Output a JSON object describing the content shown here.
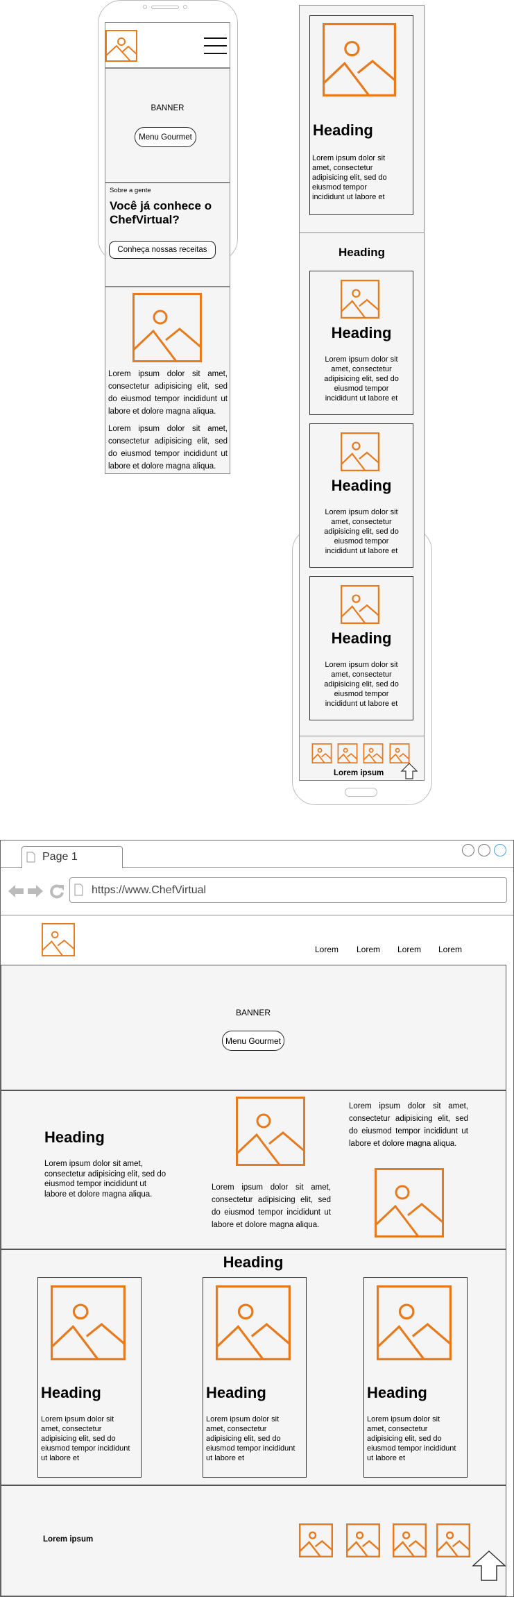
{
  "mobile_home": {
    "banner_label": "BANNER",
    "banner_button": "Menu Gourmet",
    "about_small": "Sobre a gente",
    "about_title": "Você já conhece o ChefVirtual?",
    "about_button": "Conheça nossas receitas",
    "para1": "Lorem ipsum dolor sit amet, consectetur adipisicing elit, sed do eiusmod tempor incididunt ut labore et dolore magna aliqua.",
    "para2": "Lorem ipsum dolor sit amet, consectetur adipisicing elit, sed do eiusmod tempor incididunt ut labore et dolore magna aliqua."
  },
  "mobile_list": {
    "top_card_heading": "Heading",
    "top_card_text": "Lorem ipsum dolor sit amet, consectetur adipisicing elit, sed do eiusmod tempor incididunt ut labore et",
    "section_heading": "Heading",
    "cards": [
      {
        "heading": "Heading",
        "text": "Lorem ipsum dolor sit amet, consectetur adipisicing elit, sed do eiusmod tempor incididunt ut labore et"
      },
      {
        "heading": "Heading",
        "text": "Lorem ipsum dolor sit amet, consectetur adipisicing elit, sed do eiusmod tempor incididunt ut labore et"
      },
      {
        "heading": "Heading",
        "text": "Lorem ipsum dolor sit amet, consectetur adipisicing elit, sed do eiusmod tempor incididunt ut labore et"
      }
    ],
    "footer_text": "Lorem ipsum"
  },
  "desktop": {
    "tab_title": "Page 1",
    "url": "https://www.ChefVirtual",
    "nav": [
      "Lorem",
      "Lorem",
      "Lorem",
      "Lorem"
    ],
    "banner_label": "BANNER",
    "banner_button": "Menu Gourmet",
    "about_heading": "Heading",
    "about_text": "Lorem ipsum dolor sit amet, consectetur adipisicing elit, sed do eiusmod tempor incididunt ut labore et dolore magna aliqua.",
    "middle_text": "Lorem ipsum dolor sit amet, consectetur adipisicing elit, sed do eiusmod tempor incididunt ut labore et dolore magna aliqua.",
    "right_text": "Lorem ipsum dolor sit amet, consectetur adipisicing elit, sed do eiusmod tempor incididunt ut labore et dolore magna aliqua.",
    "section_heading": "Heading",
    "cards": [
      {
        "heading": "Heading",
        "text": "Lorem ipsum dolor sit amet, consectetur adipisicing elit, sed do eiusmod tempor incididunt ut labore et"
      },
      {
        "heading": "Heading",
        "text": "Lorem ipsum dolor sit amet, consectetur adipisicing elit, sed do eiusmod tempor incididunt ut labore et"
      },
      {
        "heading": "Heading",
        "text": "Lorem ipsum dolor sit amet, consectetur adipisicing elit, sed do eiusmod tempor incididunt ut labore et"
      }
    ],
    "footer_text": "Lorem ipsum"
  },
  "colors": {
    "image_icon": "#e87a1e",
    "panel": "#f5f5f5",
    "outline": "#333333",
    "close_button": "#4aa3df"
  },
  "icons": [
    "image-placeholder-icon",
    "hamburger-menu-icon",
    "arrow-up-icon",
    "back-arrow-icon",
    "forward-arrow-icon",
    "reload-icon",
    "page-icon"
  ]
}
